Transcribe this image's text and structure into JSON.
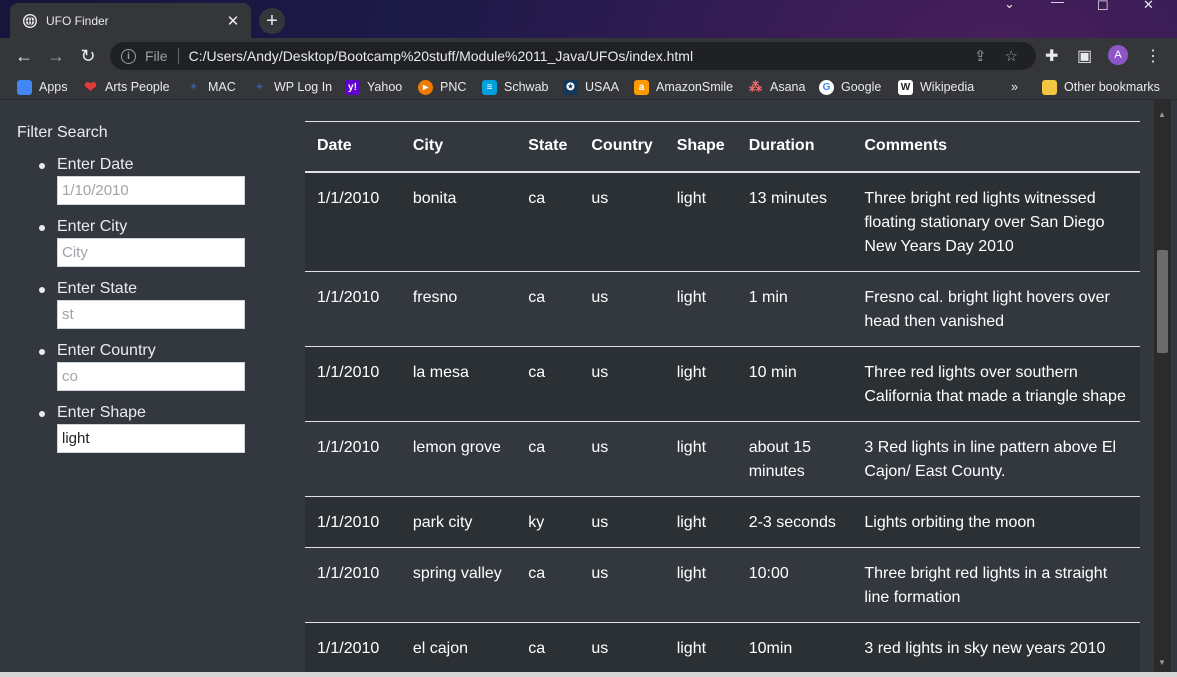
{
  "browser": {
    "tab_title": "UFO Finder",
    "new_tab_label": "+",
    "url_scheme": "File",
    "url": "C:/Users/Andy/Desktop/Bootcamp%20stuff/Module%2011_Java/UFOs/index.html",
    "avatar_initial": "A"
  },
  "bookmarks": {
    "items": [
      {
        "label": "Apps",
        "color": "#f4b400"
      },
      {
        "label": "Arts People",
        "color": "#e53935"
      },
      {
        "label": "MAC",
        "color": "#3b5998"
      },
      {
        "label": "WP Log In",
        "color": "#3b5998"
      },
      {
        "label": "Yahoo",
        "color": "#6001d2"
      },
      {
        "label": "PNC",
        "color": "#ef7c00"
      },
      {
        "label": "Schwab",
        "color": "#00a0df"
      },
      {
        "label": "USAA",
        "color": "#12395b"
      },
      {
        "label": "AmazonSmile",
        "color": "#ff9900"
      },
      {
        "label": "Asana",
        "color": "#f06a6a"
      },
      {
        "label": "Google",
        "color": "#ffffff"
      },
      {
        "label": "Wikipedia",
        "color": "#ffffff"
      }
    ],
    "more": "»",
    "other": "Other bookmarks"
  },
  "filter": {
    "title": "Filter Search",
    "fields": [
      {
        "label": "Enter Date",
        "placeholder": "1/10/2010",
        "value": ""
      },
      {
        "label": "Enter City",
        "placeholder": "City",
        "value": ""
      },
      {
        "label": "Enter State",
        "placeholder": "st",
        "value": ""
      },
      {
        "label": "Enter Country",
        "placeholder": "co",
        "value": ""
      },
      {
        "label": "Enter Shape",
        "placeholder": "",
        "value": "light"
      }
    ]
  },
  "table": {
    "headers": [
      "Date",
      "City",
      "State",
      "Country",
      "Shape",
      "Duration",
      "Comments"
    ],
    "rows": [
      [
        "1/1/2010",
        "bonita",
        "ca",
        "us",
        "light",
        "13 minutes",
        "Three bright red lights witnessed floating stationary over San Diego New Years Day 2010"
      ],
      [
        "1/1/2010",
        "fresno",
        "ca",
        "us",
        "light",
        "1 min",
        "Fresno cal. bright light hovers over head then vanished"
      ],
      [
        "1/1/2010",
        "la mesa",
        "ca",
        "us",
        "light",
        "10 min",
        "Three red lights over southern California that made a triangle shape"
      ],
      [
        "1/1/2010",
        "lemon grove",
        "ca",
        "us",
        "light",
        "about 15 minutes",
        "3 Red lights in line pattern above El Cajon/ East County."
      ],
      [
        "1/1/2010",
        "park city",
        "ky",
        "us",
        "light",
        "2-3 seconds",
        "Lights orbiting the moon"
      ],
      [
        "1/1/2010",
        "spring valley",
        "ca",
        "us",
        "light",
        "10:00",
        "Three bright red lights in a straight line formation"
      ],
      [
        "1/1/2010",
        "el cajon",
        "ca",
        "us",
        "light",
        "10min",
        "3 red lights in sky new years 2010"
      ]
    ]
  }
}
